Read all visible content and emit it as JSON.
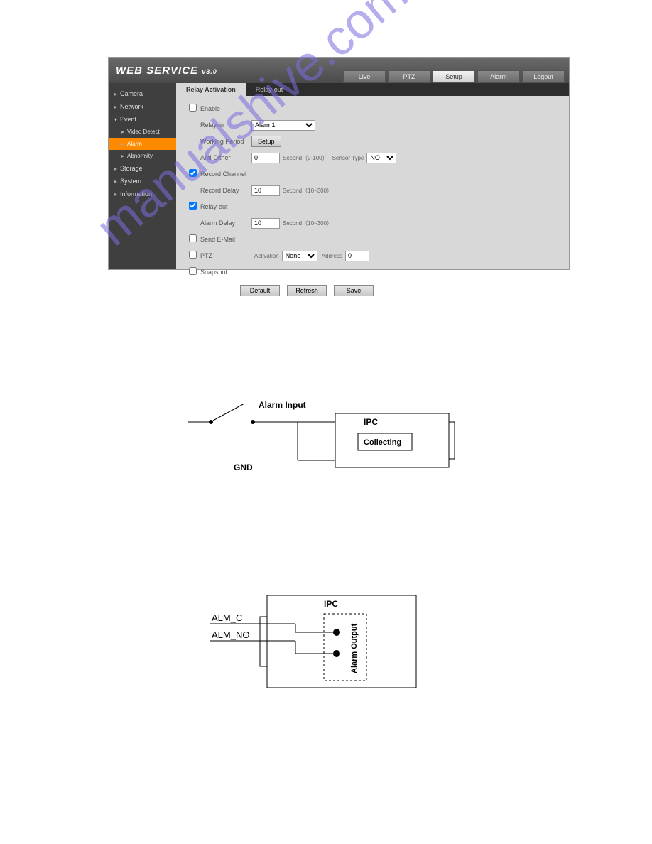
{
  "header": {
    "logo_main": "WEB  SERVICE",
    "logo_version": "v3.0",
    "nav": {
      "live": "Live",
      "ptz": "PTZ",
      "setup": "Setup",
      "alarm": "Alarm",
      "logout": "Logout"
    }
  },
  "sidebar": {
    "camera": "Camera",
    "network": "Network",
    "event": "Event",
    "video_detect": "Video Detect",
    "alarm": "Alarm",
    "abnormity": "Abnormity",
    "storage": "Storage",
    "system": "System",
    "information": "Information"
  },
  "tabs": {
    "relay_activation": "Relay Activation",
    "relay_out": "Relay-out"
  },
  "form": {
    "enable_label": "Enable",
    "relay_in_label": "Relay-in",
    "relay_in_value": "Alarm1",
    "working_period_label": "Working Period",
    "setup_btn": "Setup",
    "anti_dither_label": "Anti-Dither",
    "anti_dither_value": "0",
    "anti_dither_unit": "Second（0-100）",
    "sensor_type_label": "Sensor Type",
    "sensor_type_value": "NO",
    "record_channel_label": "Record Channel",
    "record_delay_label": "Record Delay",
    "record_delay_value": "10",
    "record_delay_unit": "Second（10~300）",
    "relay_out_label": "Relay-out",
    "alarm_delay_label": "Alarm Delay",
    "alarm_delay_value": "10",
    "alarm_delay_unit": "Second（10~300）",
    "send_email_label": "Send E-Mail",
    "ptz_label": "PTZ",
    "activation_label": "Activation",
    "activation_value": "None",
    "address_label": "Address",
    "address_value": "0",
    "snapshot_label": "Snapshot",
    "default_btn": "Default",
    "refresh_btn": "Refresh",
    "save_btn": "Save"
  },
  "diagram1": {
    "alarm_input": "Alarm Input",
    "ipc": "IPC",
    "collecting": "Collecting",
    "gnd": "GND"
  },
  "diagram2": {
    "ipc": "IPC",
    "alm_c": "ALM_C",
    "alm_no": "ALM_NO",
    "alarm_output": "Alarm Output"
  },
  "watermark": "manualshive.com"
}
